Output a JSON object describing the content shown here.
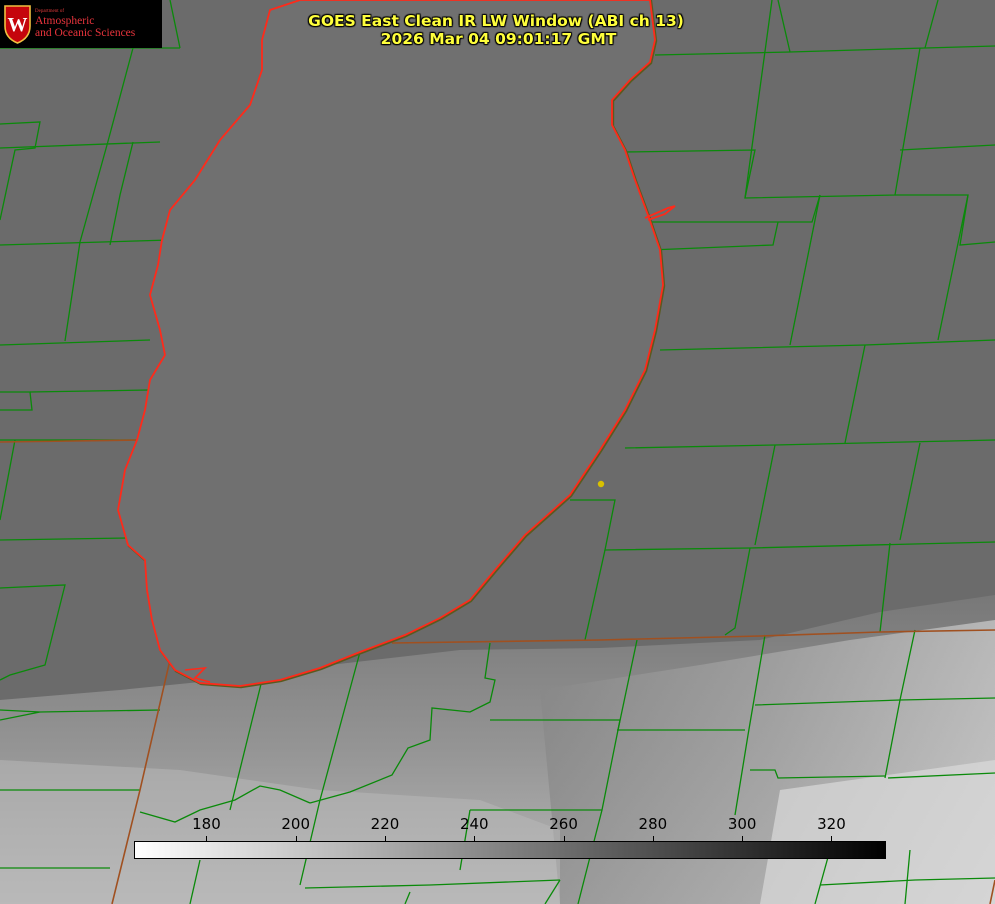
{
  "header": {
    "title_line1": "GOES East Clean IR LW Window (ABI ch 13)",
    "title_line2": "2026 Mar 04 09:01:17 GMT"
  },
  "logo": {
    "dept": "Department of",
    "line1": "Atmospheric",
    "line2": "and Oceanic Sciences",
    "crest_letter": "W"
  },
  "colorbar": {
    "vmin": 164,
    "vmax": 332,
    "ticks": [
      "180",
      "200",
      "220",
      "240",
      "260",
      "280",
      "300",
      "320"
    ],
    "colormap": "white-to-black"
  },
  "colors": {
    "lake_outline": "#ff2a1a",
    "county_lines": "#0a8a0a",
    "state_lines": "#a05020",
    "title_text": "#ffff3c",
    "marker": "#d8c000"
  }
}
